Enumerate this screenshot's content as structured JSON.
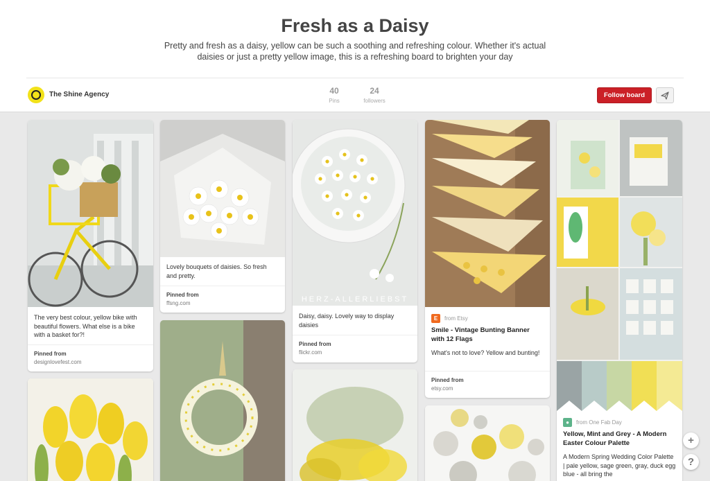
{
  "board": {
    "title": "Fresh as a Daisy",
    "description": "Pretty and fresh as a daisy, yellow can be such a soothing and refreshing colour. Whether it's actual daisies or just a pretty yellow image, this is a refreshing board to brighten your day"
  },
  "owner": {
    "name": "The Shine Agency"
  },
  "stats": {
    "pins_count": "40",
    "pins_label": "Pins",
    "followers_count": "24",
    "followers_label": "followers"
  },
  "actions": {
    "follow_label": "Follow board",
    "send_icon": "paper-plane-icon"
  },
  "pins": {
    "p1": {
      "caption": "The very best colour, yellow bike with beautiful flowers. What else is a bike with a basket for?!",
      "from_label": "Pinned from",
      "domain": "designlovefest.com"
    },
    "p2": {
      "caption": "Lovely bouquets of daisies. So fresh and pretty.",
      "from_label": "Pinned from",
      "domain": "ffsng.com"
    },
    "p3": {
      "caption": "Daisy, daisy. Lovely way to display daisies",
      "from_label": "Pinned from",
      "domain": "flickr.com",
      "watermark": "HERZ-ALLERLIEBST"
    },
    "p4": {
      "source": "from Etsy",
      "title": "Smile - Vintage Bunting Banner with 12 Flags",
      "caption": "What's not to love? Yellow and bunting!",
      "from_label": "Pinned from",
      "domain": "etsy.com"
    },
    "p5": {
      "source": "from One Fab Day",
      "title": "Yellow, Mint and Grey - A Modern Easter Colour Palette",
      "caption": "A Modern Spring Wedding Color Palette | pale yellow, sage green, gray, duck egg blue - all bring the"
    }
  },
  "floating": {
    "add": "+",
    "help": "?"
  },
  "colors": {
    "accent": "#cb2027",
    "brand_yellow": "#f2e21a",
    "background": "#e9e9e9"
  }
}
